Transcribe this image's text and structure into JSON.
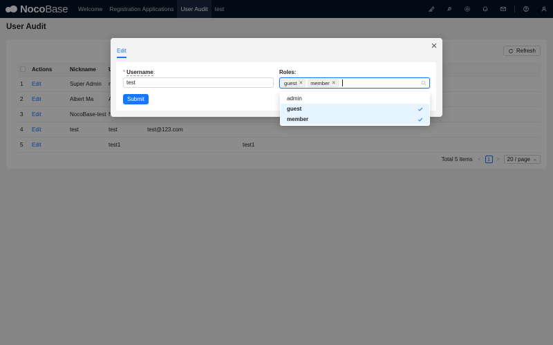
{
  "app": {
    "logo_bold": "Noco",
    "logo_light": "Base"
  },
  "nav": [
    {
      "label": "Welcome",
      "active": false
    },
    {
      "label": "Registration Applications",
      "active": false
    },
    {
      "label": "User Audit",
      "active": true
    },
    {
      "label": "test",
      "active": false
    }
  ],
  "top_icons": [
    "brush-icon",
    "plugin-icon",
    "settings-icon",
    "bell-icon",
    "mail-icon",
    "help-icon",
    "user-icon"
  ],
  "page": {
    "title": "User Audit",
    "refresh_label": "Refresh"
  },
  "table": {
    "headers": [
      "",
      "Actions",
      "Nickname",
      "U"
    ],
    "rows": [
      {
        "no": "1",
        "action": "Edit",
        "nickname": "Super Admin",
        "c3": "n",
        "c4": "",
        "c5": ""
      },
      {
        "no": "2",
        "action": "Edit",
        "nickname": "Albert Ma",
        "c3": "A",
        "c4": "",
        "c5": ""
      },
      {
        "no": "3",
        "action": "Edit",
        "nickname": "NocoBase-test",
        "c3": "N",
        "c4": "",
        "c5": ""
      },
      {
        "no": "4",
        "action": "Edit",
        "nickname": "test",
        "c3": "test",
        "c4": "test@123.com",
        "c5": ""
      },
      {
        "no": "5",
        "action": "Edit",
        "nickname": "",
        "c3": "test1",
        "c4": "",
        "c5": "test1"
      }
    ]
  },
  "pagination": {
    "total": "Total 5 items",
    "prev": "<",
    "current": "1",
    "next": ">",
    "page_size": "20 / page"
  },
  "modal": {
    "tab": "Edit",
    "username_label": "Username",
    "username_value": "test",
    "roles_label": "Roles",
    "submit_label": "Submit",
    "selected_roles": [
      "guest",
      "member"
    ],
    "role_options": [
      {
        "label": "admin",
        "selected": false
      },
      {
        "label": "guest",
        "selected": true
      },
      {
        "label": "member",
        "selected": true
      }
    ]
  },
  "colors": {
    "primary": "#1677ff",
    "header_bg": "#001529",
    "required": "#ff4d4f"
  }
}
